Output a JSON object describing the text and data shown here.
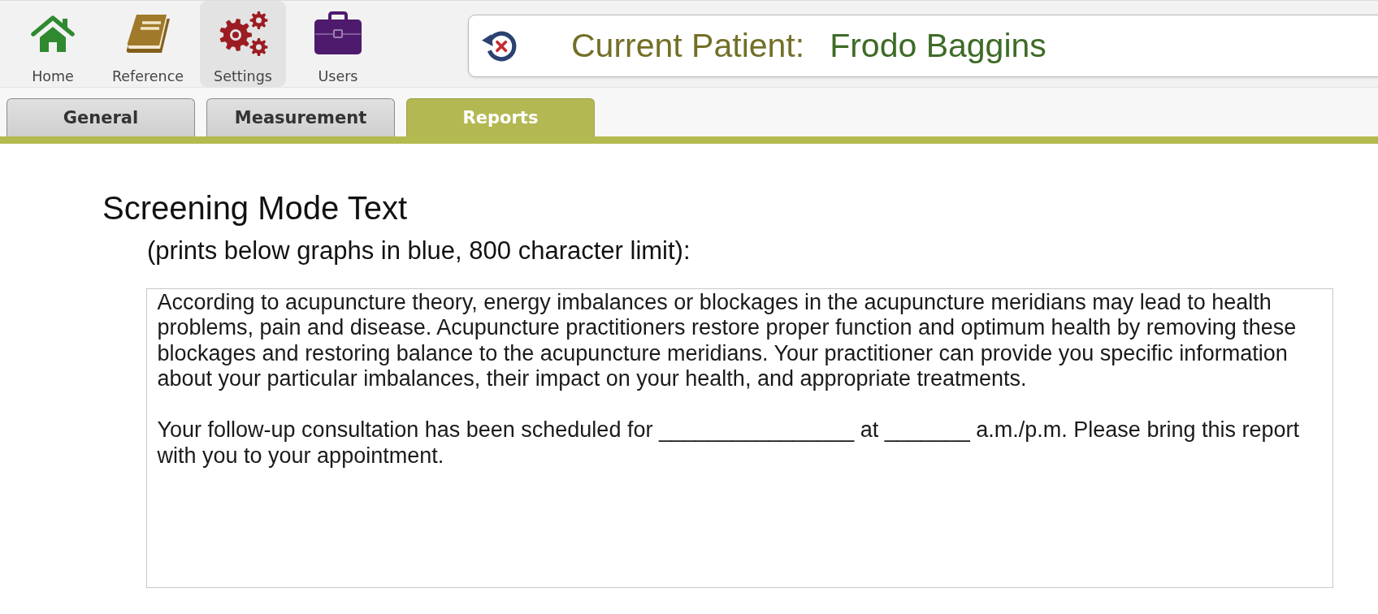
{
  "toolbar": {
    "items": [
      {
        "kind": "home",
        "label": "Home",
        "selected": false
      },
      {
        "kind": "reference",
        "label": "Reference",
        "selected": false
      },
      {
        "kind": "settings",
        "label": "Settings",
        "selected": true
      },
      {
        "kind": "users",
        "label": "Users",
        "selected": false
      }
    ]
  },
  "patient_bar": {
    "label": "Current Patient:",
    "name": "Frodo Baggins"
  },
  "tabs": [
    {
      "label": "General",
      "selected": false
    },
    {
      "label": "Measurement",
      "selected": false
    },
    {
      "label": "Reports",
      "selected": true
    }
  ],
  "section": {
    "title": "Screening Mode Text",
    "note": "(prints below graphs in blue, 800 character limit):",
    "text_area": {
      "value": "According to acupuncture theory, energy imbalances or blockages in the acupuncture meridians may lead to health problems, pain and disease. Acupuncture practitioners restore proper function and optimum health by removing these blockages and restoring balance to the acupuncture meridians. Your practitioner can provide you specific information about your particular imbalances, their impact on your health, and appropriate treatments.\n\nYour follow-up consultation has been scheduled for ________________ at _______ a.m./p.m. Please bring this report with you to your appointment."
    }
  }
}
